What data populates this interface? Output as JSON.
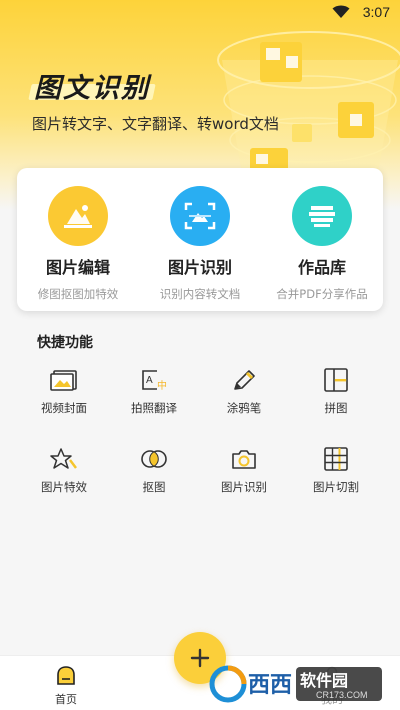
{
  "status": {
    "time": "3:07"
  },
  "hero": {
    "logo_text": "图文识别",
    "subtitle": "图片转文字、文字翻译、转word文档"
  },
  "features": [
    {
      "title": "图片编辑",
      "desc": "修图抠图加特效",
      "icon": "mountain-photo-icon",
      "color": "#fbc933"
    },
    {
      "title": "图片识别",
      "desc": "识别内容转文档",
      "icon": "scan-image-icon",
      "color": "#29aef2"
    },
    {
      "title": "作品库",
      "desc": "合并PDF分享作品",
      "icon": "stack-layers-icon",
      "color": "#2fd1c8"
    }
  ],
  "quick": {
    "title": "快捷功能",
    "items": [
      {
        "label": "视频封面",
        "icon": "video-cover-icon"
      },
      {
        "label": "拍照翻译",
        "icon": "photo-translate-icon"
      },
      {
        "label": "涂鸦笔",
        "icon": "pencil-icon"
      },
      {
        "label": "拼图",
        "icon": "collage-icon"
      },
      {
        "label": "图片特效",
        "icon": "star-effect-icon"
      },
      {
        "label": "抠图",
        "icon": "cutout-icon"
      },
      {
        "label": "图片识别",
        "icon": "camera-icon"
      },
      {
        "label": "图片切割",
        "icon": "grid-cut-icon"
      }
    ]
  },
  "tabbar": {
    "home": "首页",
    "mine": "我的",
    "fab_icon": "plus-icon"
  },
  "watermark": {
    "main": "西西软件园",
    "sub": "CR173.COM"
  },
  "colors": {
    "accent": "#fbcf3a",
    "hero_top": "#fdd33a"
  }
}
